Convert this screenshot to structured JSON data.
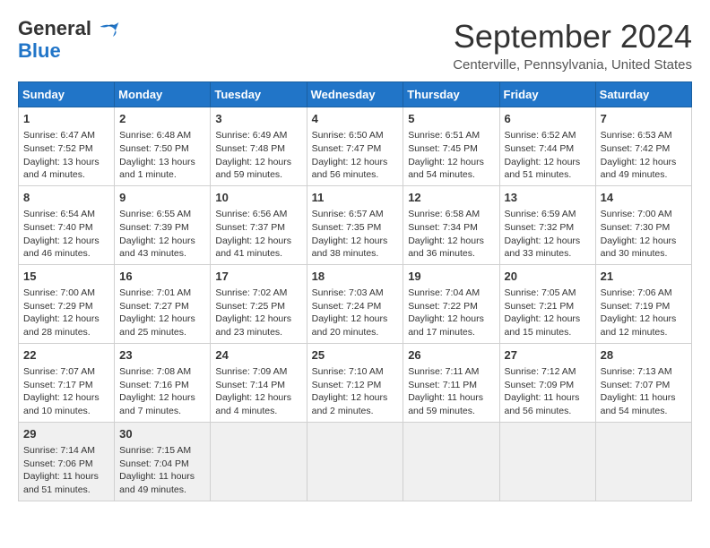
{
  "logo": {
    "line1": "General",
    "line2": "Blue"
  },
  "title": "September 2024",
  "location": "Centerville, Pennsylvania, United States",
  "headers": [
    "Sunday",
    "Monday",
    "Tuesday",
    "Wednesday",
    "Thursday",
    "Friday",
    "Saturday"
  ],
  "weeks": [
    [
      {
        "day": "1",
        "info": "Sunrise: 6:47 AM\nSunset: 7:52 PM\nDaylight: 13 hours\nand 4 minutes."
      },
      {
        "day": "2",
        "info": "Sunrise: 6:48 AM\nSunset: 7:50 PM\nDaylight: 13 hours\nand 1 minute."
      },
      {
        "day": "3",
        "info": "Sunrise: 6:49 AM\nSunset: 7:48 PM\nDaylight: 12 hours\nand 59 minutes."
      },
      {
        "day": "4",
        "info": "Sunrise: 6:50 AM\nSunset: 7:47 PM\nDaylight: 12 hours\nand 56 minutes."
      },
      {
        "day": "5",
        "info": "Sunrise: 6:51 AM\nSunset: 7:45 PM\nDaylight: 12 hours\nand 54 minutes."
      },
      {
        "day": "6",
        "info": "Sunrise: 6:52 AM\nSunset: 7:44 PM\nDaylight: 12 hours\nand 51 minutes."
      },
      {
        "day": "7",
        "info": "Sunrise: 6:53 AM\nSunset: 7:42 PM\nDaylight: 12 hours\nand 49 minutes."
      }
    ],
    [
      {
        "day": "8",
        "info": "Sunrise: 6:54 AM\nSunset: 7:40 PM\nDaylight: 12 hours\nand 46 minutes."
      },
      {
        "day": "9",
        "info": "Sunrise: 6:55 AM\nSunset: 7:39 PM\nDaylight: 12 hours\nand 43 minutes."
      },
      {
        "day": "10",
        "info": "Sunrise: 6:56 AM\nSunset: 7:37 PM\nDaylight: 12 hours\nand 41 minutes."
      },
      {
        "day": "11",
        "info": "Sunrise: 6:57 AM\nSunset: 7:35 PM\nDaylight: 12 hours\nand 38 minutes."
      },
      {
        "day": "12",
        "info": "Sunrise: 6:58 AM\nSunset: 7:34 PM\nDaylight: 12 hours\nand 36 minutes."
      },
      {
        "day": "13",
        "info": "Sunrise: 6:59 AM\nSunset: 7:32 PM\nDaylight: 12 hours\nand 33 minutes."
      },
      {
        "day": "14",
        "info": "Sunrise: 7:00 AM\nSunset: 7:30 PM\nDaylight: 12 hours\nand 30 minutes."
      }
    ],
    [
      {
        "day": "15",
        "info": "Sunrise: 7:00 AM\nSunset: 7:29 PM\nDaylight: 12 hours\nand 28 minutes."
      },
      {
        "day": "16",
        "info": "Sunrise: 7:01 AM\nSunset: 7:27 PM\nDaylight: 12 hours\nand 25 minutes."
      },
      {
        "day": "17",
        "info": "Sunrise: 7:02 AM\nSunset: 7:25 PM\nDaylight: 12 hours\nand 23 minutes."
      },
      {
        "day": "18",
        "info": "Sunrise: 7:03 AM\nSunset: 7:24 PM\nDaylight: 12 hours\nand 20 minutes."
      },
      {
        "day": "19",
        "info": "Sunrise: 7:04 AM\nSunset: 7:22 PM\nDaylight: 12 hours\nand 17 minutes."
      },
      {
        "day": "20",
        "info": "Sunrise: 7:05 AM\nSunset: 7:21 PM\nDaylight: 12 hours\nand 15 minutes."
      },
      {
        "day": "21",
        "info": "Sunrise: 7:06 AM\nSunset: 7:19 PM\nDaylight: 12 hours\nand 12 minutes."
      }
    ],
    [
      {
        "day": "22",
        "info": "Sunrise: 7:07 AM\nSunset: 7:17 PM\nDaylight: 12 hours\nand 10 minutes."
      },
      {
        "day": "23",
        "info": "Sunrise: 7:08 AM\nSunset: 7:16 PM\nDaylight: 12 hours\nand 7 minutes."
      },
      {
        "day": "24",
        "info": "Sunrise: 7:09 AM\nSunset: 7:14 PM\nDaylight: 12 hours\nand 4 minutes."
      },
      {
        "day": "25",
        "info": "Sunrise: 7:10 AM\nSunset: 7:12 PM\nDaylight: 12 hours\nand 2 minutes."
      },
      {
        "day": "26",
        "info": "Sunrise: 7:11 AM\nSunset: 7:11 PM\nDaylight: 11 hours\nand 59 minutes."
      },
      {
        "day": "27",
        "info": "Sunrise: 7:12 AM\nSunset: 7:09 PM\nDaylight: 11 hours\nand 56 minutes."
      },
      {
        "day": "28",
        "info": "Sunrise: 7:13 AM\nSunset: 7:07 PM\nDaylight: 11 hours\nand 54 minutes."
      }
    ],
    [
      {
        "day": "29",
        "info": "Sunrise: 7:14 AM\nSunset: 7:06 PM\nDaylight: 11 hours\nand 51 minutes."
      },
      {
        "day": "30",
        "info": "Sunrise: 7:15 AM\nSunset: 7:04 PM\nDaylight: 11 hours\nand 49 minutes."
      },
      {
        "day": "",
        "info": ""
      },
      {
        "day": "",
        "info": ""
      },
      {
        "day": "",
        "info": ""
      },
      {
        "day": "",
        "info": ""
      },
      {
        "day": "",
        "info": ""
      }
    ]
  ]
}
